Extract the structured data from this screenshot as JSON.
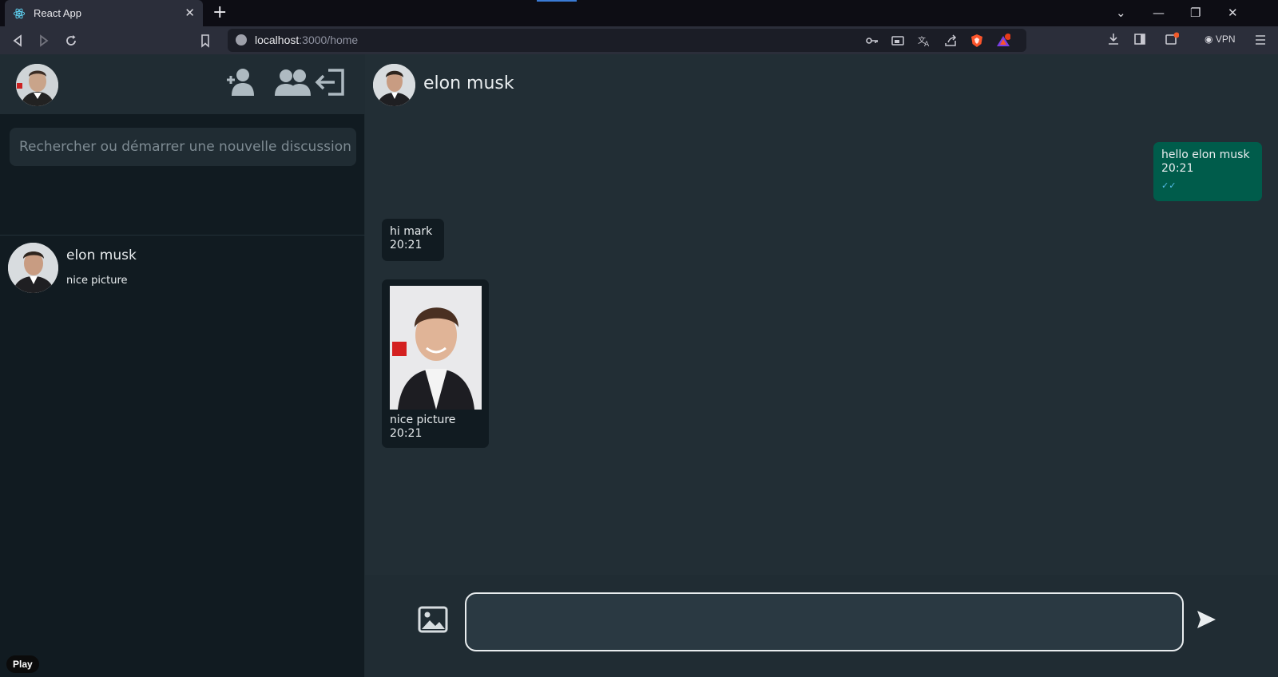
{
  "browser": {
    "tab_title": "React App",
    "url_host": "localhost",
    "url_path": ":3000/home",
    "vpn_label": "VPN",
    "icons": [
      "react-favicon-icon",
      "close-icon",
      "plus-icon",
      "back-icon",
      "forward-icon",
      "reload-icon",
      "bookmark-icon",
      "key-icon",
      "cast-icon",
      "translate-icon",
      "share-icon",
      "brave-shield-icon",
      "brave-rewards-icon",
      "download-icon",
      "sidebar-icon",
      "wallet-icon",
      "menu-icon",
      "minimize-icon",
      "restore-icon"
    ]
  },
  "sidebar": {
    "search_placeholder": "Rechercher ou démarrer une nouvelle discussion",
    "header_icons": [
      "add-contact-icon",
      "group-icon",
      "logout-icon"
    ],
    "chats": [
      {
        "name": "elon musk",
        "last_message": "nice picture"
      }
    ]
  },
  "conversation": {
    "contact_name": "elon musk",
    "messages": [
      {
        "direction": "out",
        "text": "hello elon musk",
        "time": "20:21",
        "status": "read"
      },
      {
        "direction": "in",
        "text": "hi mark",
        "time": "20:21"
      },
      {
        "direction": "in",
        "type": "image",
        "text": "nice picture",
        "time": "20:21"
      }
    ]
  },
  "composer": {
    "input_value": "",
    "image_button_icon": "image-icon",
    "send_button_icon": "send-icon"
  },
  "overlay": {
    "play_label": "Play"
  },
  "colors": {
    "sidebar_bg": "#111b21",
    "header_bg": "#202c33",
    "chat_bg": "#222e35",
    "outgoing_bubble": "#005c4b",
    "incoming_bubble": "#111b21"
  }
}
